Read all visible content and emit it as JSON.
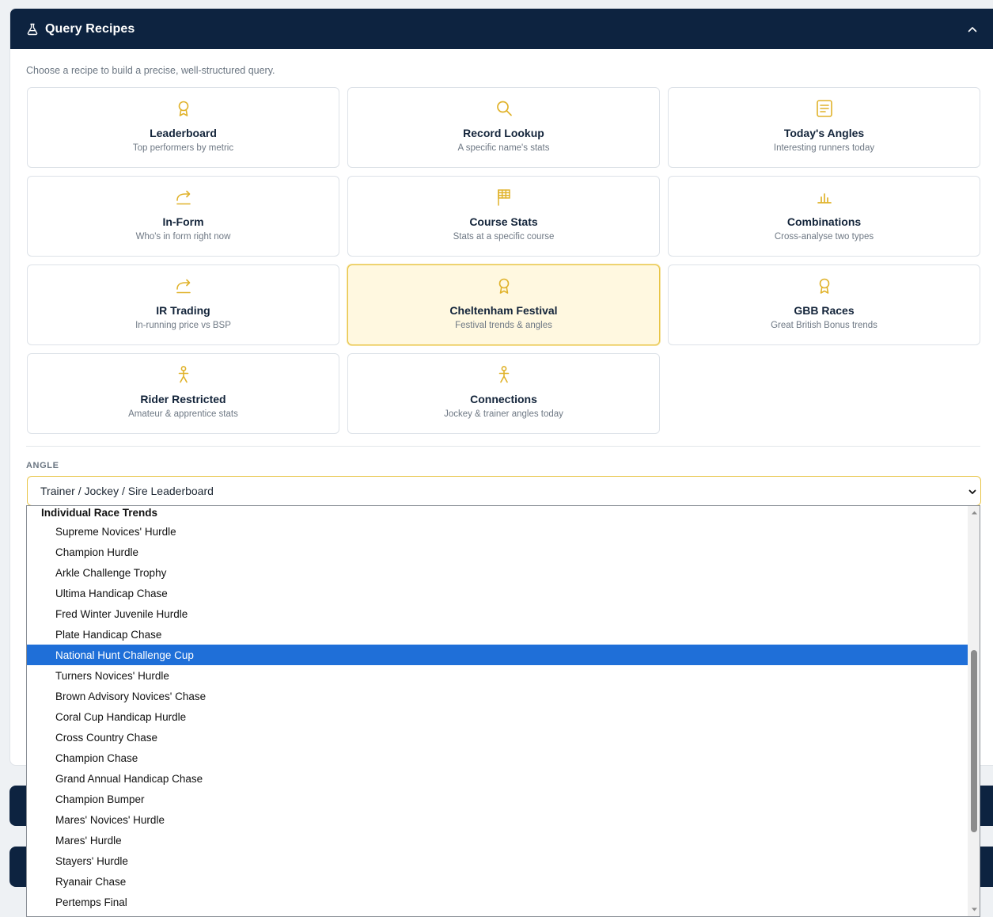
{
  "panel": {
    "title": "Query Recipes",
    "intro": "Choose a recipe to build a precise, well-structured query."
  },
  "colors": {
    "navy": "#0d2340",
    "accent": "#e0b22a",
    "active_bg": "#fff8e0",
    "selected_option": "#1f6fd8"
  },
  "recipes": [
    {
      "title": "Leaderboard",
      "subtitle": "Top performers by metric",
      "icon": "award-icon"
    },
    {
      "title": "Record Lookup",
      "subtitle": "A specific name's stats",
      "icon": "search-icon"
    },
    {
      "title": "Today's Angles",
      "subtitle": "Interesting runners today",
      "icon": "document-icon"
    },
    {
      "title": "In-Form",
      "subtitle": "Who's in form right now",
      "icon": "share-arrow-icon"
    },
    {
      "title": "Course Stats",
      "subtitle": "Stats at a specific course",
      "icon": "flag-icon"
    },
    {
      "title": "Combinations",
      "subtitle": "Cross-analyse two types",
      "icon": "bar-chart-icon"
    },
    {
      "title": "IR Trading",
      "subtitle": "In-running price vs BSP",
      "icon": "share-arrow-icon"
    },
    {
      "title": "Cheltenham Festival",
      "subtitle": "Festival trends & angles",
      "icon": "award-icon",
      "active": true
    },
    {
      "title": "GBB Races",
      "subtitle": "Great British Bonus trends",
      "icon": "award-icon"
    },
    {
      "title": "Rider Restricted",
      "subtitle": "Amateur & apprentice stats",
      "icon": "person-icon"
    },
    {
      "title": "Connections",
      "subtitle": "Jockey & trainer angles today",
      "icon": "person-icon"
    }
  ],
  "angle": {
    "label": "ANGLE",
    "selected": "Trainer / Jockey / Sire Leaderboard",
    "group_label": "Individual Race Trends",
    "options": [
      "Supreme Novices' Hurdle",
      "Champion Hurdle",
      "Arkle Challenge Trophy",
      "Ultima Handicap Chase",
      "Fred Winter Juvenile Hurdle",
      "Plate Handicap Chase",
      "National Hunt Challenge Cup",
      "Turners Novices' Hurdle",
      "Brown Advisory Novices' Chase",
      "Coral Cup Handicap Hurdle",
      "Cross Country Chase",
      "Champion Chase",
      "Grand Annual Handicap Chase",
      "Champion Bumper",
      "Mares' Novices' Hurdle",
      "Mares' Hurdle",
      "Stayers' Hurdle",
      "Ryanair Chase",
      "Pertemps Final"
    ],
    "highlighted": "National Hunt Challenge Cup"
  }
}
